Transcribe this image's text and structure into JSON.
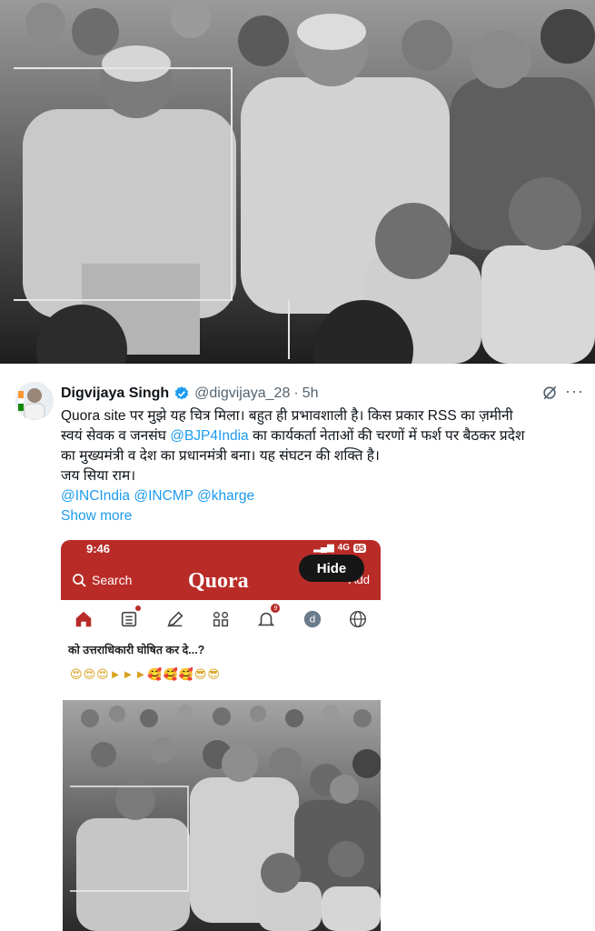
{
  "top_photo": {
    "description_icon": "black-white-group-photo"
  },
  "tweet": {
    "author_name": "Digvijaya Singh",
    "handle": "@digvijaya_28",
    "separator": "·",
    "time": "5h",
    "more_icon": "···",
    "body_line1": "Quora site पर मुझे यह चित्र मिला। बहुत ही प्रभावशाली है। किस प्रकार RSS का ज़मीनी",
    "body_line2_a": "स्वयं सेवक व जनसंघ ",
    "body_line2_mention": "@BJP4India",
    "body_line2_b": " का कार्यकर्ता नेताओं की चरणों में फर्श पर बैठकर प्रदेश",
    "body_line3": "का मुख्यमंत्री व देश का प्रधानमंत्री बना। यह संघटन की शक्ति है।",
    "body_line4": "जय सिया राम।",
    "mentions": "@INCIndia @INCMP @kharge",
    "show_more": "Show more",
    "colors": {
      "link": "#1d9bf0",
      "verified": "#1d9bf0",
      "quora_red": "#b92b27"
    }
  },
  "quora": {
    "status_time": "9:46",
    "status_network": "4G",
    "status_battery": "95",
    "search_label": "Search",
    "logo": "Quora",
    "add_label": "Add",
    "hide_button": "Hide",
    "notif_count": "9",
    "avatar_letter": "d",
    "question_text": "को उत्तराधिकारी घोषित कर दे...?",
    "emoji_row": "😍😍😍►►►🥰🥰🥰😎😎"
  }
}
